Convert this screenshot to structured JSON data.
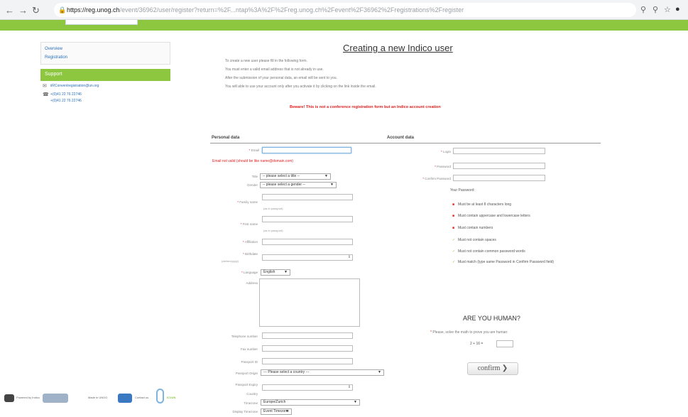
{
  "browser": {
    "url_host": "https://reg.unog.ch",
    "url_rest": "/event/36962/user/register?return=%2F...ntap%3A%2F%2Freg.unog.ch%2Fevent%2F36962%2Fregistrations%2Fregister"
  },
  "sidebar": {
    "items": [
      "Overview",
      "Registration"
    ],
    "support_label": "Support",
    "contacts": [
      "iiRConventregistration@un.org",
      "+(0)41 22 76 22746",
      "+(0)41 22 76 22746"
    ]
  },
  "page": {
    "title": "Creating a new Indico user",
    "intro": [
      "To create a new user please fill in the following form.",
      "You must enter a valid email address that is not already in use.",
      "After the submission of your personal data, an email will be sent to you.",
      "You will able to use your account only after you activate it by clicking on the link inside the email."
    ],
    "warning": "Beware! This is not a conference registration form but an Indico account creation"
  },
  "personal": {
    "heading": "Personal data",
    "email_label": "Email",
    "email_error": "Email not valid (should be like name@domain.com)",
    "title_label": "Title",
    "title_value": "-- please select a title --",
    "gender_label": "Gender",
    "gender_value": "-- please select a gender --",
    "family_label": "Family name",
    "family_sub": "(as in passport)",
    "first_label": "First name",
    "first_sub": "(as in passport)",
    "affiliation_label": "Affiliation",
    "birthdate_label": "Birthdate",
    "birthdate_sub": "(dd/mm/yyyy)",
    "language_label": "Language",
    "language_value": "English",
    "address_label": "Address",
    "telephone_label": "Telephone number",
    "fax_label": "Fax number",
    "passport_label": "Passport ID",
    "passport_origin_label": "Passport Origin",
    "passport_origin_value": "--- Please select a country ---",
    "passport_expiry_label": "Passport Expiry",
    "country_label": "Country",
    "timezone_label": "Timezone",
    "timezone_value": "Europe/Zurich",
    "display_tz_label": "Display Timezone",
    "display_tz_value": "Event Timezone"
  },
  "account": {
    "heading": "Account data",
    "login_label": "Login",
    "password_label": "Password",
    "confirm_label": "Confirm Password",
    "pw_heading": "Your Password:",
    "rules": [
      {
        "text": "Must be at least 8 characters long",
        "ok": false
      },
      {
        "text": "Must contain uppercase and lowercase letters",
        "ok": false
      },
      {
        "text": "Must contain numbers",
        "ok": false
      },
      {
        "text": "Must not contain spaces",
        "ok": true
      },
      {
        "text": "Must not contain common password words",
        "ok": true
      },
      {
        "text": "Must match (type same Password in Confirm Password field)",
        "ok": true
      }
    ]
  },
  "captcha": {
    "heading": "ARE YOU HUMAN?",
    "instruction": "Please, solve the math to prove you are human:",
    "question": "2 + 16 ="
  },
  "confirm_label": "confirm ❯",
  "footer": {
    "items": [
      "Powered by Indico",
      "Made in UNOG",
      "Contact us",
      "ICVUN"
    ]
  },
  "colors": {
    "brand_green": "#8dc63f",
    "error_red": "#e02020",
    "link_blue": "#2a6ebb"
  }
}
